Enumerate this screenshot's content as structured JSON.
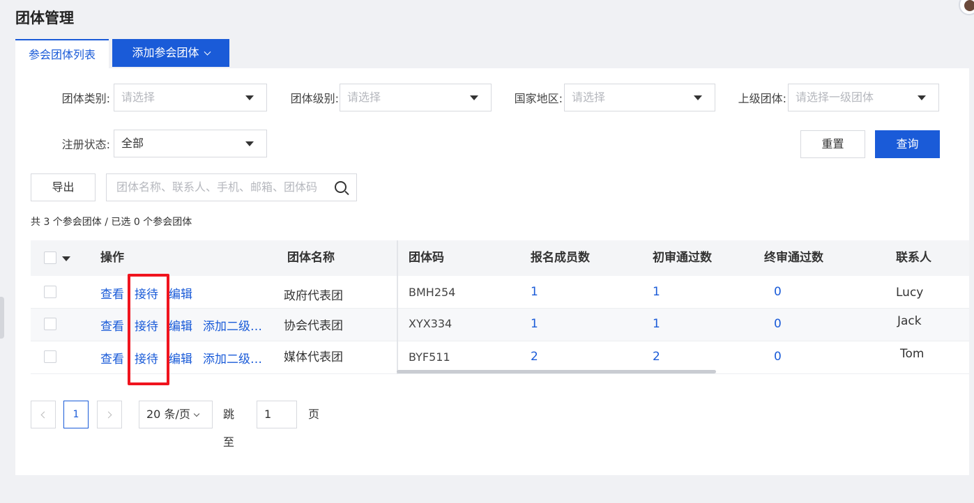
{
  "page": {
    "title": "团体管理"
  },
  "tabs": {
    "list": "参会团体列表",
    "add": "添加参会团体"
  },
  "filters": {
    "type": {
      "label": "团体类别:",
      "placeholder": "请选择"
    },
    "level": {
      "label": "团体级别:",
      "placeholder": "请选择"
    },
    "region": {
      "label": "国家地区:",
      "placeholder": "请选择"
    },
    "parent": {
      "label": "上级团体:",
      "placeholder": "请选择一级团体"
    },
    "status": {
      "label": "注册状态:",
      "value": "全部"
    }
  },
  "buttons": {
    "reset": "重置",
    "query": "查询",
    "export": "导出"
  },
  "search": {
    "placeholder": "团体名称、联系人、手机、邮箱、团体码"
  },
  "summary": "共 3 个参会团体 / 已选 0 个参会团体",
  "table": {
    "headers": {
      "actions": "操作",
      "name": "团体名称",
      "code": "团体码",
      "members": "报名成员数",
      "first_pass": "初审通过数",
      "final_pass": "终审通过数",
      "contact": "联系人"
    },
    "action_labels": {
      "view": "查看",
      "reception": "接待",
      "edit": "编辑",
      "add_sub": "添加二级…"
    },
    "rows": [
      {
        "name": "政府代表团",
        "code": "BMH254",
        "members": "1",
        "first_pass": "1",
        "final_pass": "0",
        "contact": "Lucy"
      },
      {
        "name": "协会代表团",
        "code": "XYX334",
        "members": "1",
        "first_pass": "1",
        "final_pass": "0",
        "contact": "Jack"
      },
      {
        "name": "媒体代表团",
        "code": "BYF511",
        "members": "2",
        "first_pass": "2",
        "final_pass": "0",
        "contact": "Tom"
      }
    ]
  },
  "pagination": {
    "current": "1",
    "page_size": "20 条/页",
    "jump_label": "跳至",
    "jump_value": "1",
    "page_unit": "页"
  },
  "colors": {
    "accent": "#1a5bd8",
    "highlight": "#f0141e"
  }
}
